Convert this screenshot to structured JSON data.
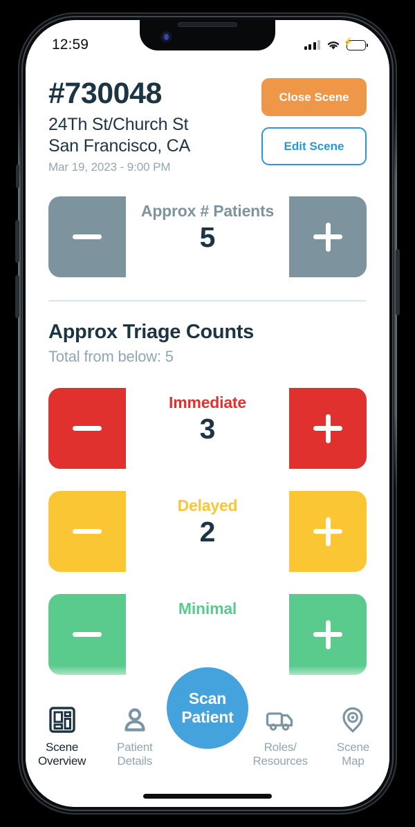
{
  "status_bar": {
    "time": "12:59",
    "signal_icon": "cellular-signal-icon",
    "wifi_icon": "wifi-icon",
    "battery_icon": "battery-charging-icon",
    "battery_glyph": "⚡"
  },
  "header": {
    "scene_id": "#730048",
    "address_line1": "24Th St/Church St",
    "address_line2": "San Francisco, CA",
    "timestamp": "Mar 19, 2023 - 9:00 PM",
    "close_label": "Close Scene",
    "edit_label": "Edit Scene",
    "close_color": "#EF9749",
    "edit_color": "#2896DD"
  },
  "patients_stepper": {
    "label": "Approx # Patients",
    "value": "5",
    "minus_icon": "minus-icon",
    "plus_icon": "plus-icon",
    "color": "#7D939E"
  },
  "triage": {
    "title": "Approx Triage Counts",
    "subtitle": "Total from below: 5",
    "total": 5,
    "categories": [
      {
        "label": "Immediate",
        "value": "3",
        "color": "#E0312E"
      },
      {
        "label": "Delayed",
        "value": "2",
        "color": "#FBC633"
      },
      {
        "label": "Minimal",
        "value": "",
        "color": "#5BCB8D"
      }
    ]
  },
  "nav": {
    "items": [
      {
        "label": "Scene\nOverview",
        "label_line1": "Scene",
        "label_line2": "Overview",
        "icon": "dashboard-grid-icon",
        "active": true
      },
      {
        "label": "Patient\nDetails",
        "label_line1": "Patient",
        "label_line2": "Details",
        "icon": "person-icon",
        "active": false
      },
      {
        "label": "Roles/\nResources",
        "label_line1": "Roles/",
        "label_line2": "Resources",
        "icon": "truck-icon",
        "active": false
      },
      {
        "label": "Scene\nMap",
        "label_line1": "Scene",
        "label_line2": "Map",
        "icon": "map-pin-icon",
        "active": false
      }
    ],
    "scan_line1": "Scan",
    "scan_line2": "Patient",
    "scan_color": "#44A3DC",
    "active_color": "#16222C",
    "inactive_color": "#8FA5B2"
  }
}
